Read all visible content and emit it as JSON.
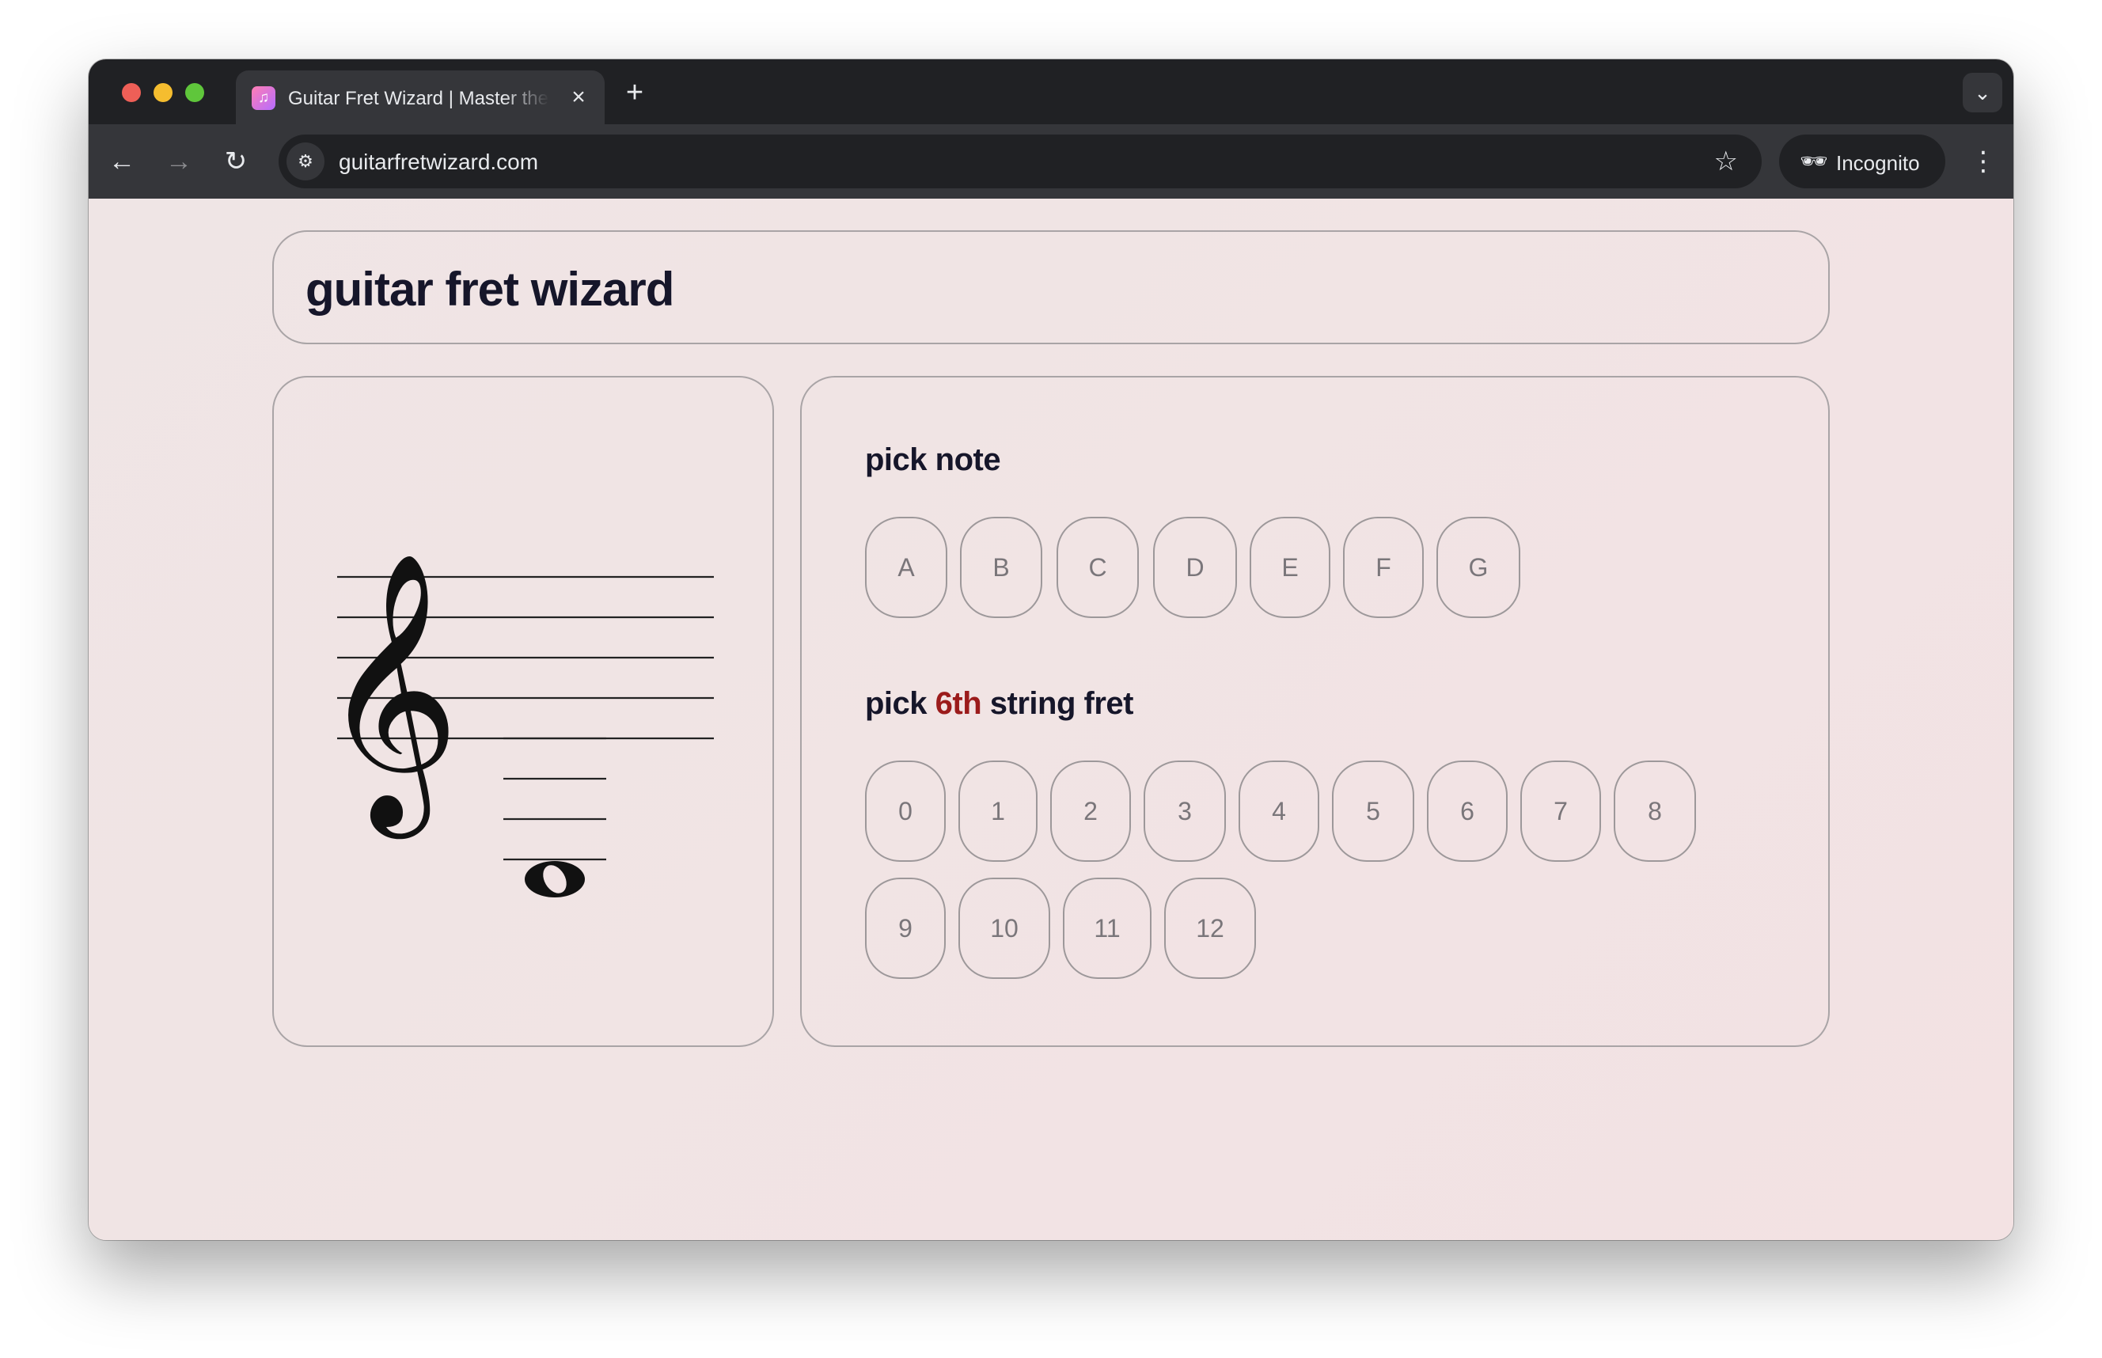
{
  "browser": {
    "tab": {
      "title": "Guitar Fret Wizard | Master the Fretboard",
      "favicon": "music-note-icon"
    },
    "url": "guitarfretwizard.com",
    "incognito_label": "Incognito"
  },
  "header": {
    "title": "guitar fret wizard"
  },
  "staff": {
    "clef": "treble-clef",
    "note": "whole-note-below-staff"
  },
  "picker": {
    "note_label": "pick note",
    "notes": [
      "A",
      "B",
      "C",
      "D",
      "E",
      "F",
      "G"
    ],
    "fret_label_prefix": "pick",
    "fret_label_string": "6th",
    "fret_label_suffix": "string fret",
    "frets": [
      "0",
      "1",
      "2",
      "3",
      "4",
      "5",
      "6",
      "7",
      "8",
      "9",
      "10",
      "11",
      "12"
    ]
  },
  "colors": {
    "page_background": "#f1e3e4",
    "accent": "#9b1b1b",
    "title_text": "#16162a",
    "coffee_button": "#fde047"
  },
  "coffee_button": {
    "icon": "coffee-cup-icon"
  }
}
